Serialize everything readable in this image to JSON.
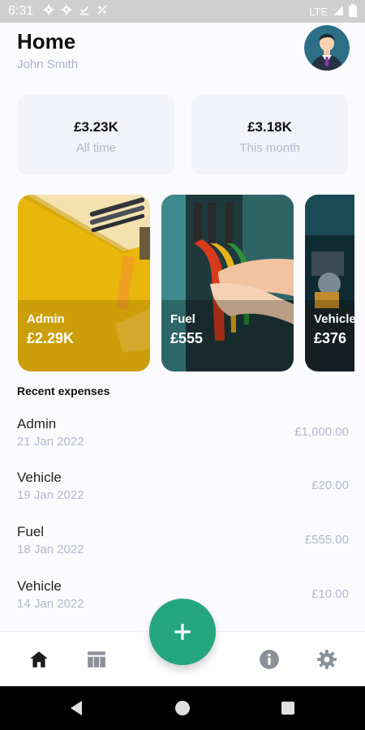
{
  "status_bar": {
    "time": "6:31",
    "network": "LTE",
    "icons": [
      "settings-icon",
      "settings-icon",
      "download-done-icon",
      "signal-off-icon",
      "signal-icon",
      "battery-icon"
    ]
  },
  "header": {
    "title": "Home",
    "user_name": "John Smith",
    "avatar_icon": "avatar-businessman"
  },
  "summary": [
    {
      "amount": "£3.23K",
      "label": "All time"
    },
    {
      "amount": "£3.18K",
      "label": "This month"
    }
  ],
  "categories": [
    {
      "name": "Admin",
      "amount": "£2.29K",
      "image": "yellow-desk-pencils"
    },
    {
      "name": "Fuel",
      "amount": "£555",
      "image": "fuel-pump-nozzles"
    },
    {
      "name": "Vehicle",
      "amount": "£376",
      "image": "car-engine"
    }
  ],
  "recent": {
    "title": "Recent expenses",
    "items": [
      {
        "name": "Admin",
        "date": "21 Jan 2022",
        "amount": "£1,000.00"
      },
      {
        "name": "Vehicle",
        "date": "19 Jan 2022",
        "amount": "£20.00"
      },
      {
        "name": "Fuel",
        "date": "18 Jan 2022",
        "amount": "£555.00"
      },
      {
        "name": "Vehicle",
        "date": "14 Jan 2022",
        "amount": "£10.00"
      }
    ]
  },
  "bottom_nav": {
    "items": [
      "home-icon",
      "table-icon",
      "add-icon",
      "info-icon",
      "settings-icon"
    ],
    "active": "home-icon",
    "accent": "#25a67e"
  },
  "system_nav": [
    "back-icon",
    "home-circle-icon",
    "recents-icon"
  ]
}
